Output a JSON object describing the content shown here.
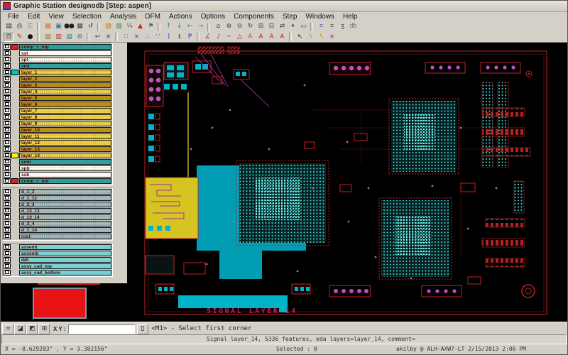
{
  "window": {
    "title": "Graphic Station designodb [Step: aspen]"
  },
  "menu": {
    "items": [
      {
        "name": "menu-item-file",
        "label": "File"
      },
      {
        "name": "menu-item-edit",
        "label": "Edit"
      },
      {
        "name": "menu-item-view",
        "label": "View"
      },
      {
        "name": "menu-item-selection",
        "label": "Selection"
      },
      {
        "name": "menu-item-analysis",
        "label": "Analysis"
      },
      {
        "name": "menu-item-dfm",
        "label": "DFM"
      },
      {
        "name": "menu-item-actions",
        "label": "Actions"
      },
      {
        "name": "menu-item-options",
        "label": "Options"
      },
      {
        "name": "menu-item-components",
        "label": "Components"
      },
      {
        "name": "menu-item-step",
        "label": "Step"
      },
      {
        "name": "menu-item-windows",
        "label": "Windows"
      },
      {
        "name": "menu-item-help",
        "label": "Help"
      }
    ]
  },
  "toolbar_top": [
    {
      "n": "save",
      "glyph": "▤",
      "color": "#333333"
    },
    {
      "n": "print",
      "glyph": "⎙",
      "color": "#333333"
    },
    {
      "n": "stamp",
      "glyph": "⎘",
      "color": "#8a7a30"
    },
    {
      "sep": true
    },
    {
      "n": "layer-table",
      "glyph": "▦",
      "color": "#c87820"
    },
    {
      "n": "image-view",
      "glyph": "▣",
      "color": "#2a8080"
    },
    {
      "n": "binoculars",
      "glyph": "●●",
      "color": "#222222"
    },
    {
      "n": "matrix",
      "glyph": "▦",
      "color": "#444444"
    },
    {
      "n": "refresh",
      "glyph": "↺",
      "color": "#444444"
    },
    {
      "sep": true
    },
    {
      "n": "step-repeat",
      "glyph": "▨",
      "color": "#c87820"
    },
    {
      "n": "layers",
      "glyph": "▧",
      "color": "#3a8a3a"
    },
    {
      "n": "fraction",
      "glyph": "¼",
      "color": "#555555"
    },
    {
      "n": "warning",
      "glyph": "▲",
      "color": "#cc2020"
    },
    {
      "n": "flag",
      "glyph": "⚑",
      "color": "#2a8a2a"
    },
    {
      "sep": true
    },
    {
      "n": "arrow-up",
      "glyph": "↑",
      "color": "#1a9090"
    },
    {
      "n": "arrow-down",
      "glyph": "↓",
      "color": "#1a9090"
    },
    {
      "n": "arrow-left",
      "glyph": "←",
      "color": "#1a9090"
    },
    {
      "n": "arrow-right",
      "glyph": "→",
      "color": "#1a9090"
    },
    {
      "sep": true
    },
    {
      "n": "home",
      "glyph": "⌂",
      "color": "#444444"
    },
    {
      "n": "zoom-in",
      "glyph": "⊕",
      "color": "#444444"
    },
    {
      "n": "zoom-out",
      "glyph": "⊖",
      "color": "#444444"
    },
    {
      "n": "zoom-previous",
      "glyph": "↻",
      "color": "#444444"
    },
    {
      "n": "tile-windows",
      "glyph": "⊞",
      "color": "#444444"
    },
    {
      "n": "cascade-windows",
      "glyph": "⊟",
      "color": "#444444"
    },
    {
      "n": "swap-view",
      "glyph": "⇄",
      "color": "#444444"
    },
    {
      "n": "find-net",
      "glyph": "⌖",
      "color": "#222222"
    },
    {
      "n": "monitor",
      "glyph": "▭",
      "color": "#7040a0"
    },
    {
      "sep": true
    },
    {
      "n": "grid-purple",
      "glyph": "⌗",
      "color": "#7040a0"
    },
    {
      "n": "grid",
      "glyph": "⌗",
      "color": "#444444"
    },
    {
      "n": "snapshot",
      "glyph": "ʒ",
      "color": "#444444"
    },
    {
      "n": "db-meter",
      "glyph": "db",
      "color": "#777777"
    }
  ],
  "toolbar_edit": [
    {
      "n": "select-area",
      "glyph": "⊡",
      "color": "#333333",
      "cls": "pressed"
    },
    {
      "n": "draw-erase",
      "glyph": "✎",
      "color": "#aa3030"
    },
    {
      "n": "filled-circle",
      "glyph": "●",
      "color": "#111111"
    },
    {
      "sep": true
    },
    {
      "n": "pads-top",
      "glyph": "▤",
      "color": "#9a6a20"
    },
    {
      "n": "pads-mark",
      "glyph": "▥",
      "color": "#b03838"
    },
    {
      "n": "pads-bottom",
      "glyph": "▤",
      "color": "#2a7a7a"
    },
    {
      "n": "eye",
      "glyph": "⊙",
      "color": "#333333"
    },
    {
      "sep": true
    },
    {
      "n": "undo",
      "glyph": "↩",
      "color": "#444444"
    },
    {
      "n": "delete",
      "glyph": "×",
      "color": "#333333"
    },
    {
      "sep": true
    },
    {
      "n": "select-points",
      "glyph": "∷",
      "color": "#2040c0"
    },
    {
      "n": "delete-point",
      "glyph": "×",
      "color": "#2040c0"
    },
    {
      "n": "add-vertex",
      "glyph": "∴",
      "color": "#2040c0"
    },
    {
      "n": "move-vertex",
      "glyph": "∵",
      "color": "#2040c0"
    },
    {
      "n": "arc",
      "glyph": ")",
      "color": "#2040c0"
    },
    {
      "n": "snap-pad",
      "glyph": "‡",
      "color": "#2040c0"
    },
    {
      "n": "route-pad",
      "glyph": "P",
      "color": "#2040c0"
    },
    {
      "sep": true
    },
    {
      "n": "measure-angle",
      "glyph": "∠",
      "color": "#c02020"
    },
    {
      "n": "measure-slope",
      "glyph": "∕",
      "color": "#c02020"
    },
    {
      "n": "measure-line",
      "glyph": "─",
      "color": "#c02020"
    },
    {
      "n": "measure-triangle",
      "glyph": "△",
      "color": "#c02020"
    },
    {
      "n": "text-outline",
      "glyph": "A",
      "color": "#c05050"
    },
    {
      "n": "text-filled",
      "glyph": "A",
      "color": "#c02020"
    },
    {
      "n": "text-wide",
      "glyph": "A",
      "color": "#c02020"
    },
    {
      "n": "text-frame",
      "glyph": "A",
      "color": "#c02020"
    },
    {
      "sep": true
    },
    {
      "n": "cursor",
      "glyph": "↖",
      "color": "#222222"
    },
    {
      "n": "highlight-net",
      "glyph": "ϟ",
      "color": "#c8a000"
    },
    {
      "n": "highlight-comp",
      "glyph": "ϟ",
      "color": "#c8a000"
    },
    {
      "n": "clear-highlight",
      "glyph": "×",
      "color": "#c02020"
    }
  ],
  "layers": {
    "main": [
      {
        "label": "comp_+_top",
        "cls": "c-teal tex",
        "swatch": "#e02020"
      },
      {
        "label": "sst",
        "cls": "c-white"
      },
      {
        "label": "spt",
        "cls": "c-white tex"
      },
      {
        "label": "smt",
        "cls": "c-teal"
      },
      {
        "label": "layer_1",
        "cls": "c-yellow tex",
        "swatch": "#00c8c8"
      },
      {
        "label": "layer_2",
        "cls": "c-olive"
      },
      {
        "label": "layer_3",
        "cls": "c-olive tex"
      },
      {
        "label": "layer_4",
        "cls": "c-yellow tex"
      },
      {
        "label": "layer_5",
        "cls": "c-olive"
      },
      {
        "label": "layer_6",
        "cls": "c-olive"
      },
      {
        "label": "layer_7",
        "cls": "c-yellow tex"
      },
      {
        "label": "layer_8",
        "cls": "c-yellow tex"
      },
      {
        "label": "layer_9",
        "cls": "c-yellow tex"
      },
      {
        "label": "layer_10",
        "cls": "c-olive"
      },
      {
        "label": "layer_11",
        "cls": "c-yellow tex"
      },
      {
        "label": "layer_12",
        "cls": "c-yellow tex"
      },
      {
        "label": "layer_13",
        "cls": "c-olive"
      },
      {
        "label": "layer_14",
        "cls": "c-yellow tex",
        "swatch": "#f8f800"
      },
      {
        "label": "smb",
        "cls": "c-teal"
      },
      {
        "label": "spb",
        "cls": "c-white tex"
      },
      {
        "label": "ssb",
        "cls": "c-white"
      },
      {
        "label": "comp_+_bot",
        "cls": "c-teal tex",
        "swatch": "#e02020"
      }
    ],
    "drill": [
      {
        "label": "d_1_2",
        "cls": "c-gray tex"
      },
      {
        "label": "d_1_12",
        "cls": "c-gray tex"
      },
      {
        "label": "d_2_3",
        "cls": "c-gray tex"
      },
      {
        "label": "d_12_13",
        "cls": "c-gray tex"
      },
      {
        "label": "d_13_14",
        "cls": "c-gray tex"
      },
      {
        "label": "d_3_4",
        "cls": "c-gray tex"
      },
      {
        "label": "d_1_14",
        "cls": "c-gray tex"
      },
      {
        "label": "rout",
        "cls": "c-gray tex"
      }
    ],
    "misc": [
      {
        "label": "assemt",
        "cls": "c-cyan"
      },
      {
        "label": "assemb",
        "cls": "c-cyan"
      },
      {
        "label": "ddt",
        "cls": "c-cyan"
      },
      {
        "label": "assy_cad_top",
        "cls": "c-cyan"
      },
      {
        "label": "assy_cad_bottom",
        "cls": "c-cyan"
      }
    ]
  },
  "command_bar": {
    "buttons": [
      {
        "n": "overlay-compare",
        "glyph": "≍",
        "color": "#333333"
      },
      {
        "n": "clip-area",
        "glyph": "◪",
        "color": "#333333"
      },
      {
        "n": "clip-inverse",
        "glyph": "◩",
        "color": "#333333"
      },
      {
        "n": "grid-toggle",
        "glyph": "⊞",
        "color": "#333333"
      }
    ],
    "xy_label": "X Y :",
    "xy_value": "",
    "mode_glyph": "▯",
    "hint": "<M1> - Select first corner"
  },
  "status": {
    "layer_info": "Signal layer_14, 5336 features, eda layers=layer_14, comment=",
    "coords": "X = -0.629203\" , Y = 3.382156\"",
    "selected": "Selected : 0",
    "session": "akilby @ ALH-AXW7-LT 2/15/2013  2:06 PM"
  },
  "canvas": {
    "board_label": "SIGNAL LAYER 14"
  },
  "colors": {
    "board_red": "#c22222",
    "pcb_cyan": "#00b4c8",
    "pcb_magenta": "#c050c0",
    "pcb_yellow": "#d6c520",
    "layer_teal": "#2f9f9f"
  }
}
